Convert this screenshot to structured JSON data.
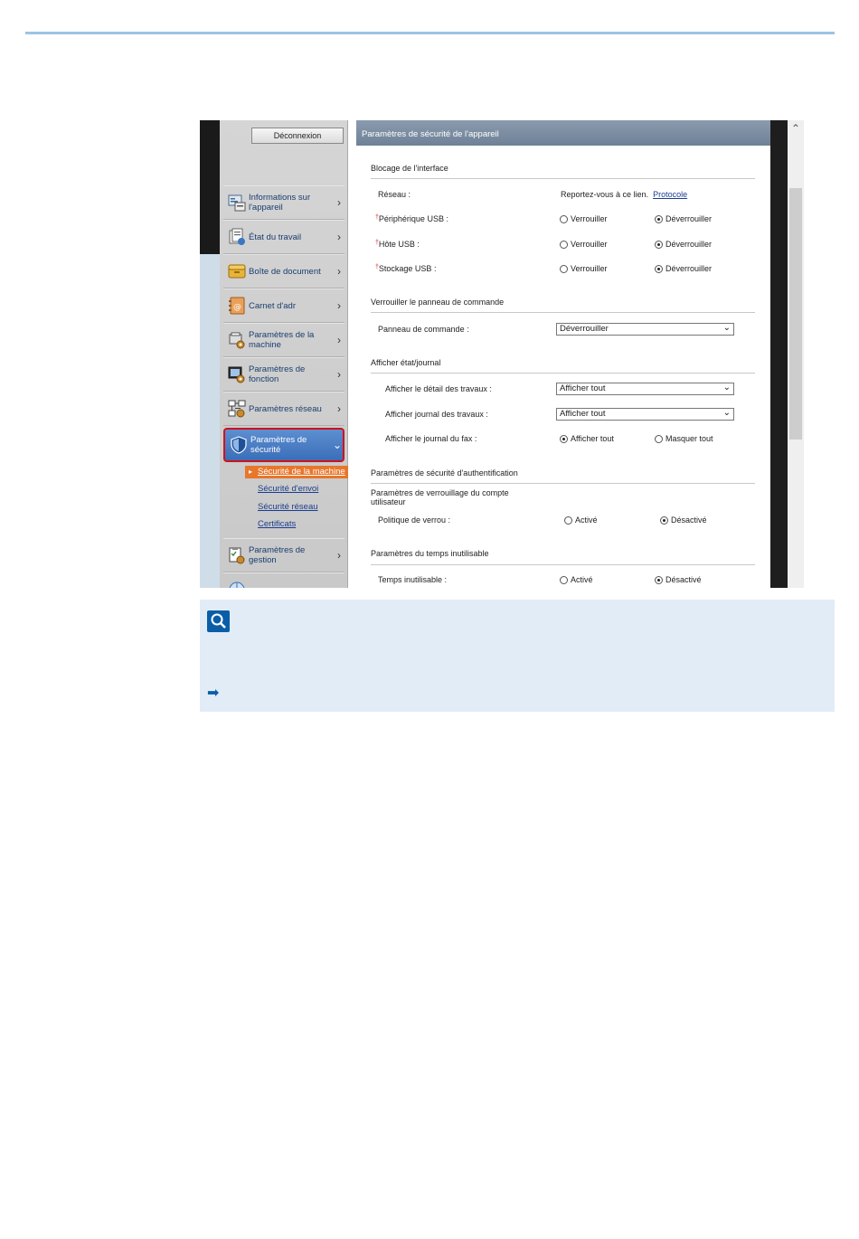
{
  "sidebar": {
    "logout_label": "Déconnexion",
    "items": [
      {
        "label": "Informations sur l'appareil"
      },
      {
        "label": "État du travail"
      },
      {
        "label": "Boîte de document"
      },
      {
        "label": "Carnet d'adr"
      },
      {
        "label": "Paramètres de la machine"
      },
      {
        "label": "Paramètres de fonction"
      },
      {
        "label": "Paramètres réseau"
      },
      {
        "label": "Paramètres de sécurité"
      },
      {
        "label": "Paramètres de gestion"
      }
    ],
    "subitems": [
      {
        "label": "Sécurité de la machine"
      },
      {
        "label": "Sécurité d'envoi"
      },
      {
        "label": "Sécurité réseau"
      },
      {
        "label": "Certificats"
      }
    ]
  },
  "content": {
    "header": "Paramètres de sécurité de l'appareil",
    "interface_lock": {
      "title": "Blocage de l'interface",
      "network_label": "Réseau :",
      "network_value": "Reportez-vous à ce lien.",
      "network_link": "Protocole",
      "usb_device_label": "Périphérique USB :",
      "usb_host_label": "Hôte USB :",
      "usb_storage_label": "Stockage USB :",
      "lock": "Verrouiller",
      "unlock": "Déverrouiller"
    },
    "panel_lock": {
      "title": "Verrouiller le panneau de commande",
      "label": "Panneau de commande :",
      "value": "Déverrouiller"
    },
    "status_log": {
      "title": "Afficher état/journal",
      "job_detail_label": "Afficher le détail des travaux :",
      "job_detail_value": "Afficher tout",
      "job_log_label": "Afficher journal des travaux :",
      "job_log_value": "Afficher tout",
      "fax_log_label": "Afficher le journal du fax :",
      "show_all": "Afficher tout",
      "hide_all": "Masquer tout"
    },
    "auth_security": {
      "title": "Paramètres de sécurité d'authentification",
      "lockout_title": "Paramètres de verrouillage du compte utilisateur",
      "policy_label": "Politique de verrou :",
      "on": "Activé",
      "off": "Désactivé"
    },
    "idle": {
      "title": "Paramètres du temps inutilisable",
      "label": "Temps inutilisable :",
      "on": "Activé",
      "off": "Désactivé"
    }
  }
}
